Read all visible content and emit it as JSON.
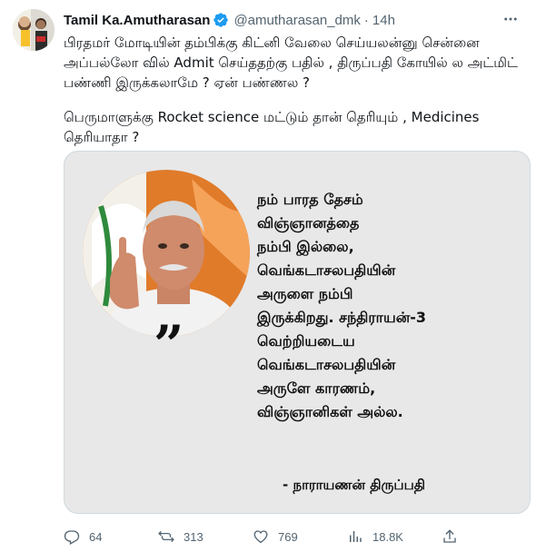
{
  "author": {
    "display_name": "Tamil Ka.Amutharasan",
    "handle": "@amutharasan_dmk",
    "timestamp": "14h",
    "verified": true
  },
  "tweet": {
    "paragraphs": [
      "பிரதமர் மோடியின் தம்பிக்கு கிட்னி வேலை செய்யலன்னு சென்னை அப்பல்லோ வில் Admit செய்ததற்கு பதில் , திருப்பதி கோயில் ல அட்மிட் பண்ணி இருக்கலாமே ? ஏன் பண்ணல ?",
      "பெருமாளுக்கு Rocket science மட்டும் தான் தெரியும் , Medicines தெரியாதா ?"
    ]
  },
  "media": {
    "quote_mark": "”",
    "quote_lines": [
      "நம் பாரத தேசம்",
      "விஞ்ஞானத்தை",
      "நம்பி இல்லை,",
      "வெங்கடாசலபதியின்",
      "அருளை நம்பி",
      "இருக்கிறது. சந்திராயன்-3",
      "வெற்றியடைய",
      "வெங்கடாசலபதியின்",
      "அருளே காரணம்,",
      "விஞ்ஞானிகள் அல்ல."
    ],
    "attribution": "- நாராயணன் திருப்பதி"
  },
  "actions": {
    "replies": "64",
    "retweets": "313",
    "likes": "769",
    "views": "18.8K"
  },
  "icons": {
    "more": "more-icon",
    "verified": "verified-badge-icon",
    "reply": "reply-icon",
    "retweet": "retweet-icon",
    "like": "heart-icon",
    "views": "views-icon",
    "share": "share-icon"
  },
  "colors": {
    "text": "#0f1419",
    "secondary": "#536471",
    "verified": "#1d9bf0",
    "border": "#cfd9de",
    "media_bg": "#e8e8e8"
  }
}
